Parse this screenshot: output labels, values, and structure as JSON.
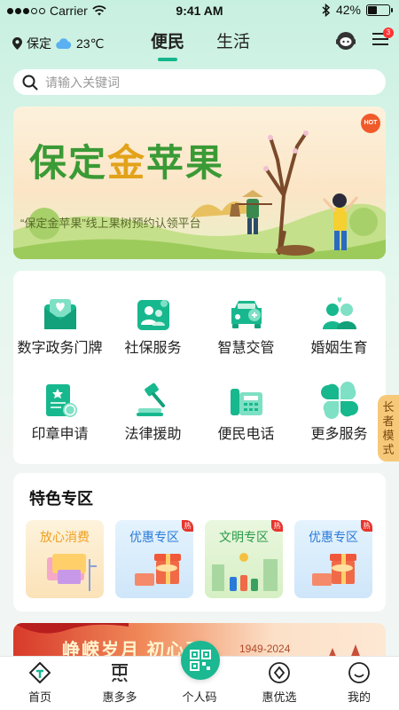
{
  "status_bar": {
    "carrier": "Carrier",
    "time": "9:41 AM",
    "battery": "42%",
    "battery_level": 0.42
  },
  "header": {
    "city": "保定",
    "temperature": "23℃",
    "tabs": [
      {
        "label": "便民",
        "active": true
      },
      {
        "label": "生活",
        "active": false
      }
    ],
    "notification_count": "3"
  },
  "search": {
    "placeholder": "请输入关键词"
  },
  "banner": {
    "title_part1": "保定",
    "title_gold": "金",
    "title_part2": "苹果",
    "subtitle": "“保定金苹果”线上果树预约认领平台",
    "hot_tag": "HOT"
  },
  "services": [
    {
      "label": "数字政务门牌",
      "icon": "envelope-heart-icon"
    },
    {
      "label": "社保服务",
      "icon": "people-card-icon"
    },
    {
      "label": "智慧交管",
      "icon": "car-icon"
    },
    {
      "label": "婚姻生育",
      "icon": "couple-icon"
    },
    {
      "label": "印章申请",
      "icon": "seal-document-icon"
    },
    {
      "label": "法律援助",
      "icon": "gavel-icon"
    },
    {
      "label": "便民电话",
      "icon": "telephone-icon"
    },
    {
      "label": "更多服务",
      "icon": "four-leaf-icon"
    }
  ],
  "elder_mode": "长者模式",
  "featured": {
    "title": "特色专区",
    "hot_label": "热",
    "cards": [
      {
        "label": "放心消费",
        "hot": false,
        "color": "#f0a020"
      },
      {
        "label": "优惠专区",
        "hot": true,
        "color": "#2a7ad8"
      },
      {
        "label": "文明专区",
        "hot": true,
        "color": "#2a9a4a"
      },
      {
        "label": "优惠专区",
        "hot": true,
        "color": "#2a7ad8"
      }
    ]
  },
  "promo": {
    "text": "峥嵘岁月 初心不",
    "years": "1949-2024"
  },
  "tabbar": [
    {
      "label": "首页",
      "icon": "home-icon"
    },
    {
      "label": "惠多多",
      "icon": "hui-icon"
    },
    {
      "label": "个人码",
      "icon": "qr-code-icon"
    },
    {
      "label": "惠优选",
      "icon": "circle-select-icon"
    },
    {
      "label": "我的",
      "icon": "user-face-icon"
    }
  ],
  "colors": {
    "accent": "#14b58c",
    "badge": "#f33333"
  }
}
